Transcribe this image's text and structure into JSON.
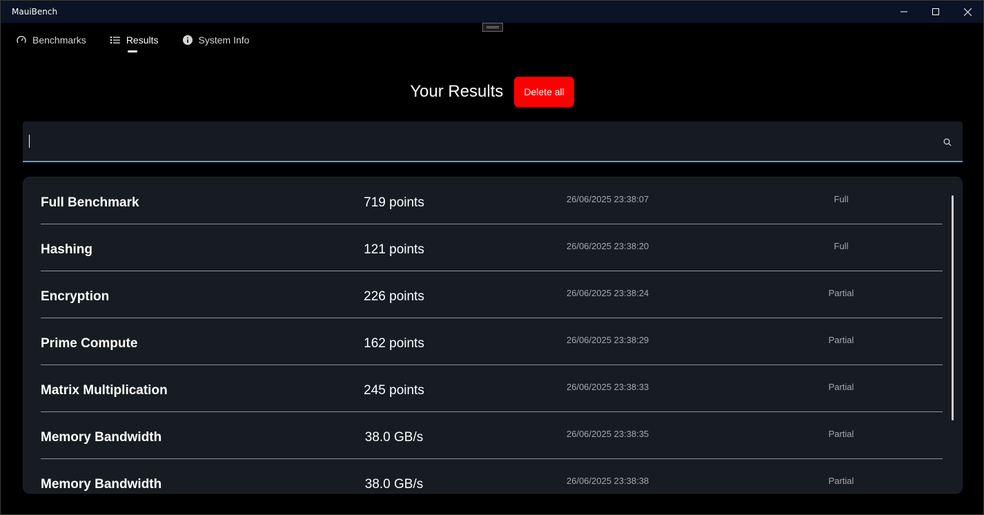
{
  "app": {
    "title": "MauiBench"
  },
  "window_controls": {
    "minimize_icon": "minimize-icon",
    "maximize_icon": "maximize-icon",
    "close_icon": "close-icon"
  },
  "tabs": [
    {
      "label": "Benchmarks",
      "icon": "gauge-icon",
      "active": false
    },
    {
      "label": "Results",
      "icon": "list-icon",
      "active": true
    },
    {
      "label": "System Info",
      "icon": "info-icon",
      "active": false
    }
  ],
  "header": {
    "title": "Your Results",
    "delete_all_label": "Delete all"
  },
  "search": {
    "value": "",
    "placeholder": "",
    "icon": "search-icon"
  },
  "colors": {
    "accent": "#4aa3e0",
    "danger": "#ff0000",
    "card_bg": "#171c22",
    "titlebar_bg": "#0b1326"
  },
  "results": [
    {
      "name": "Full Benchmark",
      "score": "719 points",
      "date": "26/06/2025 23:38:07",
      "type": "Full"
    },
    {
      "name": "Hashing",
      "score": "121 points",
      "date": "26/06/2025 23:38:20",
      "type": "Full"
    },
    {
      "name": "Encryption",
      "score": "226 points",
      "date": "26/06/2025 23:38:24",
      "type": "Partial"
    },
    {
      "name": "Prime Compute",
      "score": "162 points",
      "date": "26/06/2025 23:38:29",
      "type": "Partial"
    },
    {
      "name": "Matrix Multiplication",
      "score": "245 points",
      "date": "26/06/2025 23:38:33",
      "type": "Partial"
    },
    {
      "name": "Memory Bandwidth",
      "score": "38.0 GB/s",
      "date": "26/06/2025 23:38:35",
      "type": "Partial"
    },
    {
      "name": "Memory Bandwidth",
      "score": "38.0 GB/s",
      "date": "26/06/2025 23:38:38",
      "type": "Partial"
    }
  ]
}
